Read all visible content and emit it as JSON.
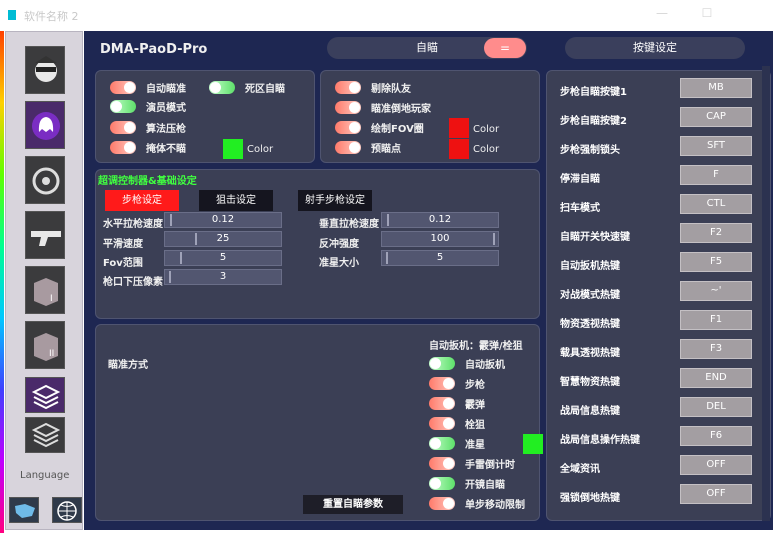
{
  "window": {
    "title": "软件名称 2"
  },
  "brand": "DMA-PaoD-Pro",
  "header": {
    "aim_pill": "自瞄",
    "eq_button": "=",
    "hotkey_pill": "按键设定"
  },
  "toggles_left": [
    {
      "label": "自动瞄准",
      "state": "on"
    },
    {
      "label": "死区自瞄",
      "state": "off"
    },
    {
      "label": "演员模式",
      "state": "off"
    },
    {
      "label": "算法压枪",
      "state": "on"
    },
    {
      "label": "掩体不瞄",
      "state": "on"
    }
  ],
  "color_left": {
    "label": "Color",
    "color": "#22ee22"
  },
  "toggles_right": [
    {
      "label": "剔除队友",
      "state": "on"
    },
    {
      "label": "瞄准倒地玩家",
      "state": "on"
    },
    {
      "label": "绘制FOV圈",
      "state": "on"
    },
    {
      "label": "预瞄点",
      "state": "on"
    }
  ],
  "color_right": [
    {
      "label": "Color",
      "color": "#ee1111"
    },
    {
      "label": "Color",
      "color": "#ee1111"
    }
  ],
  "section_title": "超调控制器&基础设定",
  "weapon_tabs": [
    "步枪设定",
    "狙击设定",
    "射手步枪设定"
  ],
  "sliders_left": [
    {
      "label": "水平拉枪速度",
      "value": "0.12",
      "fraction": 0.03
    },
    {
      "label": "平滑速度",
      "value": "25",
      "fraction": 0.25
    },
    {
      "label": "Fov范围",
      "value": "5",
      "fraction": 0.12
    },
    {
      "label": "枪口下压像素",
      "value": "3",
      "fraction": 0.02
    }
  ],
  "sliders_right": [
    {
      "label": "垂直拉枪速度",
      "value": "0.12",
      "fraction": 0.03
    },
    {
      "label": "反冲强度",
      "value": "100",
      "fraction": 0.99
    },
    {
      "label": "准星大小",
      "value": "5",
      "fraction": 0.02
    }
  ],
  "aim_method_label": "瞄准方式",
  "auto_trigger_title": "自动扳机：霰弹/栓狙",
  "trigger_toggles": [
    {
      "label": "自动扳机",
      "state": "off"
    },
    {
      "label": "步枪",
      "state": "on"
    },
    {
      "label": "霰弹",
      "state": "on"
    },
    {
      "label": "栓狙",
      "state": "on"
    },
    {
      "label": "准星",
      "state": "off"
    },
    {
      "label": "手雷倒计时",
      "state": "on"
    },
    {
      "label": "开镜自瞄",
      "state": "off"
    },
    {
      "label": "单步移动限制",
      "state": "on"
    }
  ],
  "crosshair_color": "#22ee22",
  "reset_button": "重置自瞄参数",
  "hotkeys": [
    {
      "label": "步枪自瞄按键1",
      "key": "MB"
    },
    {
      "label": "步枪自瞄按键2",
      "key": "CAP"
    },
    {
      "label": "步枪强制锁头",
      "key": "SFT"
    },
    {
      "label": "停滞自瞄",
      "key": "F"
    },
    {
      "label": "扫车模式",
      "key": "CTL"
    },
    {
      "label": "自瞄开关快速键",
      "key": "F2"
    },
    {
      "label": "自动扳机热键",
      "key": "F5"
    },
    {
      "label": "对战模式热键",
      "key": "~'"
    },
    {
      "label": "物资透视热键",
      "key": "F1"
    },
    {
      "label": "载具透视热键",
      "key": "F3"
    },
    {
      "label": "智慧物资热键",
      "key": "END"
    },
    {
      "label": "战局信息热键",
      "key": "DEL"
    },
    {
      "label": "战局信息操作热键",
      "key": "F6"
    },
    {
      "label": "全域资讯",
      "key": "OFF"
    },
    {
      "label": "强锁倒地热键",
      "key": "OFF"
    }
  ],
  "sidebar": {
    "language_label": "Language"
  }
}
